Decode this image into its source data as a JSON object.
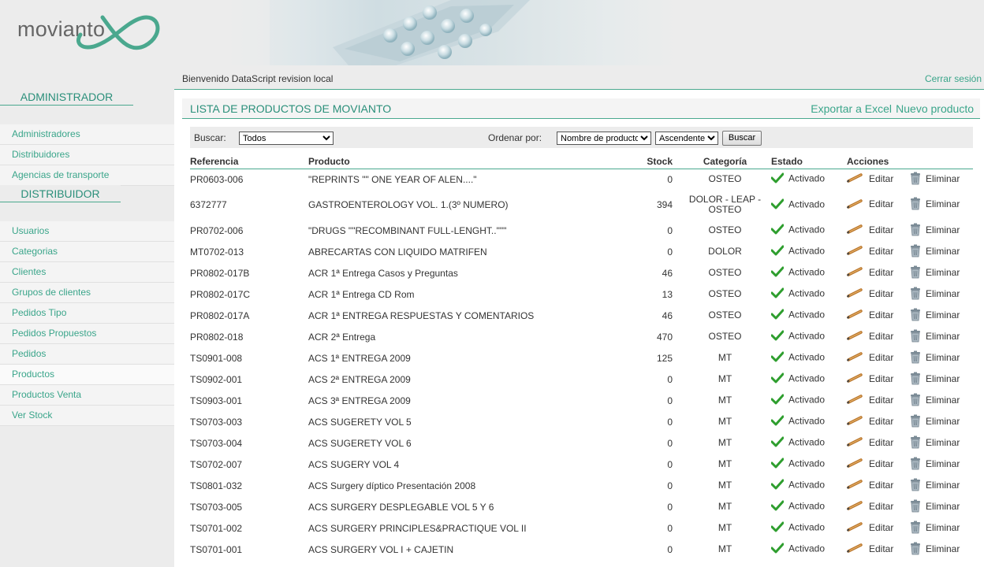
{
  "header": {
    "logo_text": "movianto"
  },
  "sidebar": {
    "admin_title": "ADMINISTRADOR",
    "admin_items": [
      {
        "label": "Administradores"
      },
      {
        "label": "Distribuidores"
      },
      {
        "label": "Agencias de transporte"
      }
    ],
    "dist_title": "DISTRIBUIDOR",
    "dist_items": [
      {
        "label": "Usuarios"
      },
      {
        "label": "Categorias"
      },
      {
        "label": "Clientes"
      },
      {
        "label": "Grupos de clientes"
      },
      {
        "label": "Pedidos Tipo"
      },
      {
        "label": "Pedidos Propuestos"
      },
      {
        "label": "Pedidos"
      },
      {
        "label": "Productos"
      },
      {
        "label": "Productos Venta"
      },
      {
        "label": "Ver Stock"
      }
    ]
  },
  "topbar": {
    "welcome": "Bienvenido DataScript revision local",
    "logout": "Cerrar sesión"
  },
  "list": {
    "title": "LISTA DE PRODUCTOS DE MOVIANTO",
    "export": "Exportar a Excel",
    "new": "Nuevo producto"
  },
  "filters": {
    "search_label": "Buscar:",
    "search_value": "Todos",
    "order_label": "Ordenar por:",
    "order_value": "Nombre de producto",
    "direction_value": "Ascendente",
    "button": "Buscar"
  },
  "table": {
    "columns": [
      "Referencia",
      "Producto",
      "Stock",
      "Categoría",
      "Estado",
      "Acciones"
    ],
    "status_label": "Activado",
    "edit_label": "Editar",
    "delete_label": "Eliminar",
    "rows": [
      {
        "ref": "PR0603-006",
        "product": "\"REPRINTS \"\" ONE YEAR OF ALEN....\"",
        "stock": "0",
        "category": "OSTEO"
      },
      {
        "ref": "6372777",
        "product": "GASTROENTEROLOGY VOL. 1.(3º NUMERO)",
        "stock": "394",
        "category": "DOLOR - LEAP - OSTEO"
      },
      {
        "ref": "PR0702-006",
        "product": "\"DRUGS \"\"RECOMBINANT FULL-LENGHT..\"\"\"",
        "stock": "0",
        "category": "OSTEO"
      },
      {
        "ref": "MT0702-013",
        "product": "ABRECARTAS CON LIQUIDO MATRIFEN",
        "stock": "0",
        "category": "DOLOR"
      },
      {
        "ref": "PR0802-017B",
        "product": "ACR 1ª Entrega Casos y Preguntas",
        "stock": "46",
        "category": "OSTEO"
      },
      {
        "ref": "PR0802-017C",
        "product": "ACR 1ª Entrega CD Rom",
        "stock": "13",
        "category": "OSTEO"
      },
      {
        "ref": "PR0802-017A",
        "product": "ACR 1ª ENTREGA RESPUESTAS Y COMENTARIOS",
        "stock": "46",
        "category": "OSTEO"
      },
      {
        "ref": "PR0802-018",
        "product": "ACR 2ª Entrega",
        "stock": "470",
        "category": "OSTEO"
      },
      {
        "ref": "TS0901-008",
        "product": "ACS 1ª ENTREGA 2009",
        "stock": "125",
        "category": "MT"
      },
      {
        "ref": "TS0902-001",
        "product": "ACS 2ª ENTREGA 2009",
        "stock": "0",
        "category": "MT"
      },
      {
        "ref": "TS0903-001",
        "product": "ACS 3ª ENTREGA 2009",
        "stock": "0",
        "category": "MT"
      },
      {
        "ref": "TS0703-003",
        "product": "ACS SUGERETY VOL 5",
        "stock": "0",
        "category": "MT"
      },
      {
        "ref": "TS0703-004",
        "product": "ACS SUGERETY VOL 6",
        "stock": "0",
        "category": "MT"
      },
      {
        "ref": "TS0702-007",
        "product": "ACS SUGERY VOL 4",
        "stock": "0",
        "category": "MT"
      },
      {
        "ref": "TS0801-032",
        "product": "ACS Surgery díptico Presentación 2008",
        "stock": "0",
        "category": "MT"
      },
      {
        "ref": "TS0703-005",
        "product": "ACS SURGERY DESPLEGABLE VOL 5 Y 6",
        "stock": "0",
        "category": "MT"
      },
      {
        "ref": "TS0701-002",
        "product": "ACS SURGERY PRINCIPLES&PRACTIQUE VOL II",
        "stock": "0",
        "category": "MT"
      },
      {
        "ref": "TS0701-001",
        "product": "ACS SURGERY VOL I + CAJETIN",
        "stock": "0",
        "category": "MT"
      }
    ]
  },
  "colors": {
    "accent": "#3aa58a",
    "rule": "#4aa88e",
    "check": "#2e9e2e"
  }
}
